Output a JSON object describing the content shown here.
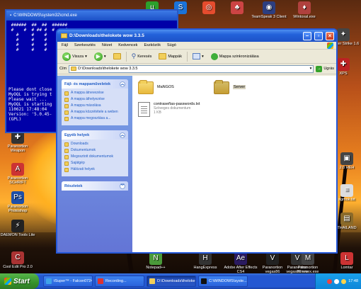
{
  "desktop": {
    "icons": [
      {
        "label": "",
        "color": "#2ca02c",
        "glyph": "µ"
      },
      {
        "label": "",
        "color": "#1b73d9",
        "glyph": "S"
      },
      {
        "label": "",
        "color": "#e54c2e",
        "glyph": "◎"
      },
      {
        "label": "",
        "color": "#cc4444",
        "glyph": "♣"
      },
      {
        "label": "TeamSpeak 3 Client",
        "color": "#2c3e80",
        "glyph": "◉"
      },
      {
        "label": "Wintoxal.exe",
        "color": "#b0413e",
        "glyph": "♦"
      },
      {
        "label": "Counter Strike 1.6",
        "color": "#444",
        "glyph": "✦"
      },
      {
        "label": "XPS",
        "color": "#b22",
        "glyph": "✚"
      },
      {
        "label": "Paranortion Weapon",
        "color": "#333",
        "glyph": "✚"
      },
      {
        "label": "Paranortion SCHRIFT",
        "color": "#c33",
        "glyph": "A"
      },
      {
        "label": "Paranortion Photoshop",
        "color": "#1d4fa8",
        "glyph": "Ps"
      },
      {
        "label": "DAEMON Tools Lite",
        "color": "#222",
        "glyph": "⚡"
      },
      {
        "label": "Cool Edit Pro 2.0",
        "color": "#a33",
        "glyph": "C"
      },
      {
        "label": "Notepad++",
        "color": "#4a9a3a",
        "glyph": "N"
      },
      {
        "label": "HangExpress",
        "color": "#333",
        "glyph": "H"
      },
      {
        "label": "Adobe After Effects CS4",
        "color": "#2a1a60",
        "glyph": "Ae"
      },
      {
        "label": "Paranortion vegas86",
        "color": "#222",
        "glyph": "V"
      },
      {
        "label": "Paranortion vegas86.exe",
        "color": "#333",
        "glyph": "V"
      },
      {
        "label": "Paranortion mmvsex.exe",
        "color": "#444",
        "glyph": "M"
      },
      {
        "label": "Lomtar",
        "color": "#c33",
        "glyph": "L"
      },
      {
        "label": "sgmok.txt",
        "color": "#ddd",
        "glyph": "≡"
      },
      {
        "label": "THAILAND",
        "color": "#8a6a2a",
        "glyph": "▤"
      },
      {
        "label": "2.0 HEH",
        "color": "#444",
        "glyph": "▣"
      }
    ]
  },
  "console": {
    "title": "C:\\WINDOWS\\system32\\cmd.exe",
    "lines": [
      " ######  ##  ##  ######",
      " #    #  # ## #  #    #",
      "   #     #    #    #",
      "   #     #    #    #",
      "   #     #    #    #",
      "   #     #    #    #",
      "",
      "",
      "",
      "",
      "",
      "",
      "",
      "Please dont close",
      "MyOQL is trying t",
      "Please wait ...",
      "MyOQL is starting",
      "110621 17:48:04",
      "Version: '5.0.45-",
      "(GPL)"
    ]
  },
  "explorer": {
    "title": "D:\\Downloads\\thelokete wow 3.3.5",
    "menu": [
      "Fájl",
      "Szerkesztés",
      "Nézet",
      "Kedvencek",
      "Eszközök",
      "Súgó"
    ],
    "toolbar": {
      "back": "Vissza",
      "search": "Keresés",
      "folders": "Mappák",
      "sync": "Mappa szinkronizálása"
    },
    "address": {
      "label": "Cím",
      "value": "D:\\Downloads\\thelokete wow 3.3.5",
      "go": "Ugrás"
    },
    "tasks_panel": {
      "title": "Fájl- és mappaműveletek",
      "items": [
        "A mappa átnevezése",
        "A mappa áthelyezése",
        "A mappa másolása",
        "A mappa közzététele a weben",
        "A mappa megosztása a..."
      ]
    },
    "places_panel": {
      "title": "Egyéb helyek",
      "items": [
        "Downloads",
        "Dokumentumok",
        "Megosztott dokumentumok",
        "Sajátgép",
        "Hálózati helyek"
      ]
    },
    "details_panel": {
      "title": "Részletek"
    },
    "files": [
      {
        "name": "MaNGOS",
        "kind": "folder"
      },
      {
        "name": "Server",
        "kind": "folder-selected"
      },
      {
        "name": "contraseñas-passwords.txt",
        "sub1": "Szöveges dokumentum",
        "sub2": "1 KB",
        "kind": "txt"
      }
    ]
  },
  "taskbar": {
    "start": "Start",
    "tasks": [
      {
        "label": "tSuper™ - Falcon0724",
        "color": "#3fa2e8"
      },
      {
        "label": "Recording...",
        "color": "#d33"
      },
      {
        "label": "D:\\Downloads\\theloke...",
        "color": "#f2cf5a",
        "active": true
      },
      {
        "label": "C:\\WINDOWS\\syste...",
        "color": "#111"
      }
    ],
    "clock": "17:48"
  }
}
